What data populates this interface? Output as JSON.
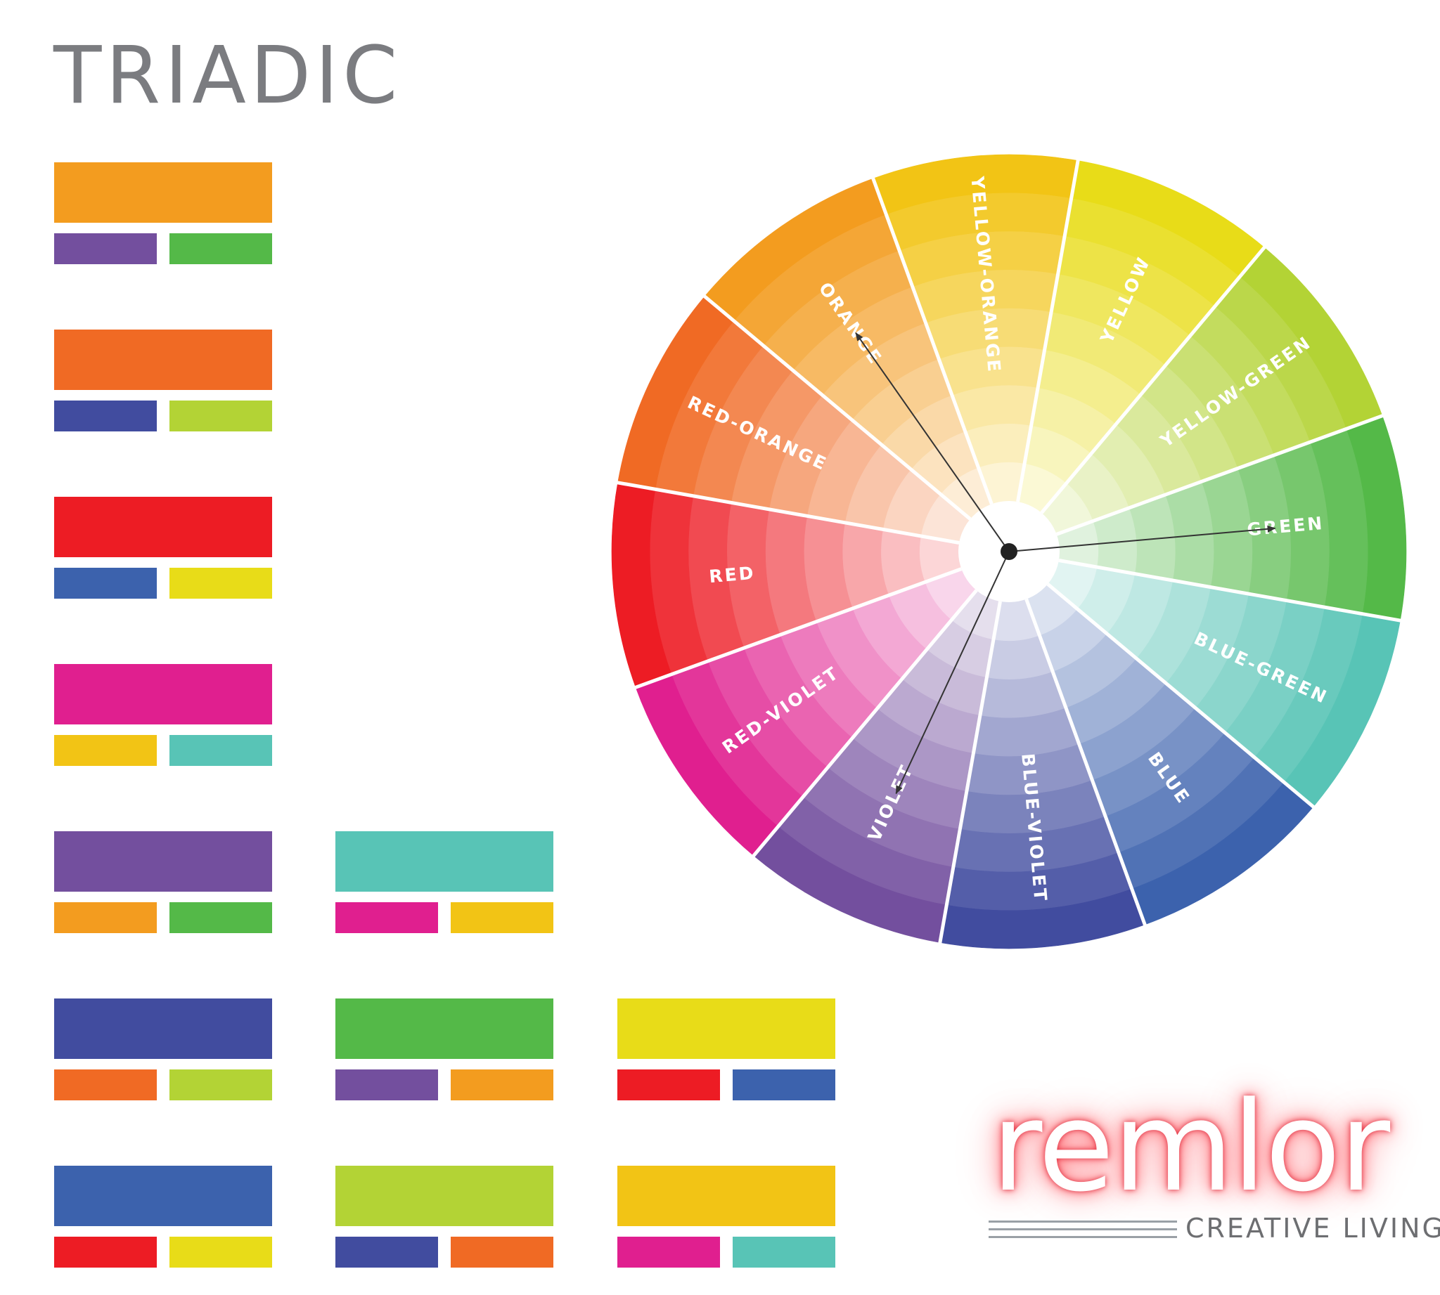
{
  "title": "TRIADIC",
  "swatches": [
    {
      "main": "#f39c1f",
      "a": "#734f9e",
      "b": "#54b948"
    },
    {
      "main": "#f06a24",
      "a": "#414c9f",
      "b": "#b3d335"
    },
    {
      "main": "#ed1c24",
      "a": "#3c62ad",
      "b": "#e8dc18"
    },
    {
      "main": "#e01f8f",
      "a": "#f2c415",
      "b": "#58c4b6"
    },
    {
      "main": "#734f9e",
      "a": "#f39c1f",
      "b": "#54b948"
    },
    {
      "main": "#58c4b6",
      "a": "#e01f8f",
      "b": "#f2c415"
    },
    {
      "main": "#414c9f",
      "a": "#f06a24",
      "b": "#b3d335"
    },
    {
      "main": "#54b948",
      "a": "#734f9e",
      "b": "#f39c1f"
    },
    {
      "main": "#e8dc18",
      "a": "#ed1c24",
      "b": "#3c62ad"
    },
    {
      "main": "#3c62ad",
      "a": "#ed1c24",
      "b": "#e8dc18"
    },
    {
      "main": "#b3d335",
      "a": "#414c9f",
      "b": "#f06a24"
    },
    {
      "main": "#f2c415",
      "a": "#e01f8f",
      "b": "#58c4b6"
    }
  ],
  "wheel": {
    "segments": [
      {
        "label": "YELLOW-ORANGE",
        "color": "#f2c415"
      },
      {
        "label": "YELLOW",
        "color": "#e8dc18"
      },
      {
        "label": "YELLOW-GREEN",
        "color": "#b3d335"
      },
      {
        "label": "GREEN",
        "color": "#54b948"
      },
      {
        "label": "BLUE-GREEN",
        "color": "#58c4b6"
      },
      {
        "label": "BLUE",
        "color": "#3c62ad"
      },
      {
        "label": "BLUE-VIOLET",
        "color": "#414c9f"
      },
      {
        "label": "VIOLET",
        "color": "#734f9e"
      },
      {
        "label": "RED-VIOLET",
        "color": "#e01f8f"
      },
      {
        "label": "RED",
        "color": "#ed1c24"
      },
      {
        "label": "RED-ORANGE",
        "color": "#f06a24"
      },
      {
        "label": "ORANGE",
        "color": "#f39c1f"
      }
    ],
    "arrow_targets": [
      "ORANGE",
      "GREEN",
      "VIOLET"
    ]
  },
  "logo": {
    "word": "remlor",
    "tagline": "CREATIVE LIVING"
  }
}
